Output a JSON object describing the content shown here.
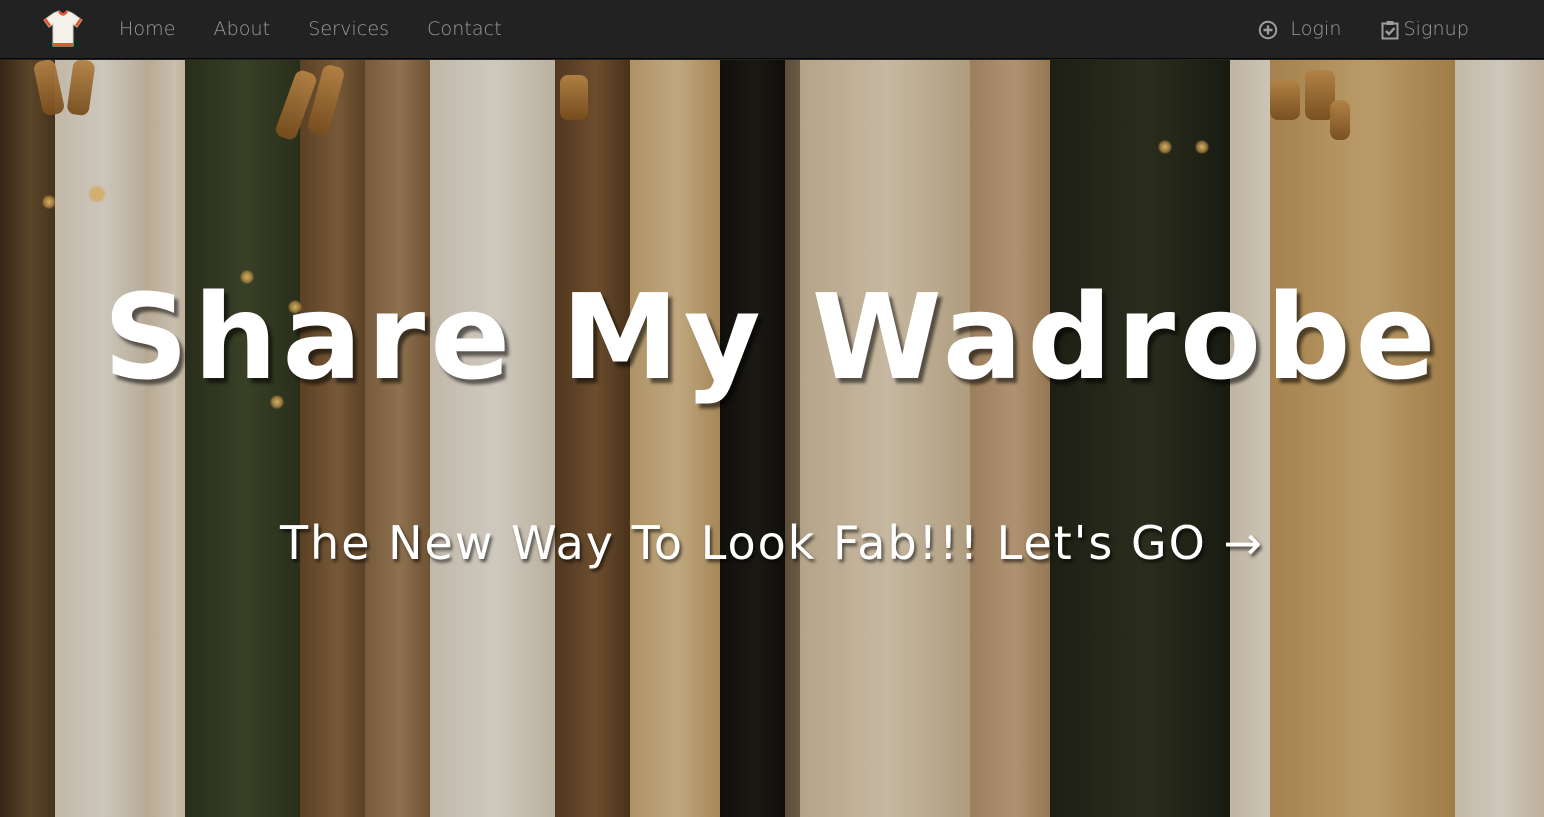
{
  "navbar": {
    "brand_icon": "tshirt-icon",
    "links": [
      {
        "label": "Home"
      },
      {
        "label": "About"
      },
      {
        "label": "Services"
      },
      {
        "label": "Contact"
      }
    ],
    "auth": {
      "login_label": "Login",
      "login_icon": "plus-circle-icon",
      "signup_label": "Signup",
      "signup_icon": "clipboard-check-icon"
    },
    "background_color": "#222222",
    "link_color": "#9d9d9d"
  },
  "hero": {
    "title": "Share My Wadrobe",
    "subtitle": "The New Way To Look Fab!!! Let's GO →",
    "background_image": "clothing-rack-photo"
  }
}
